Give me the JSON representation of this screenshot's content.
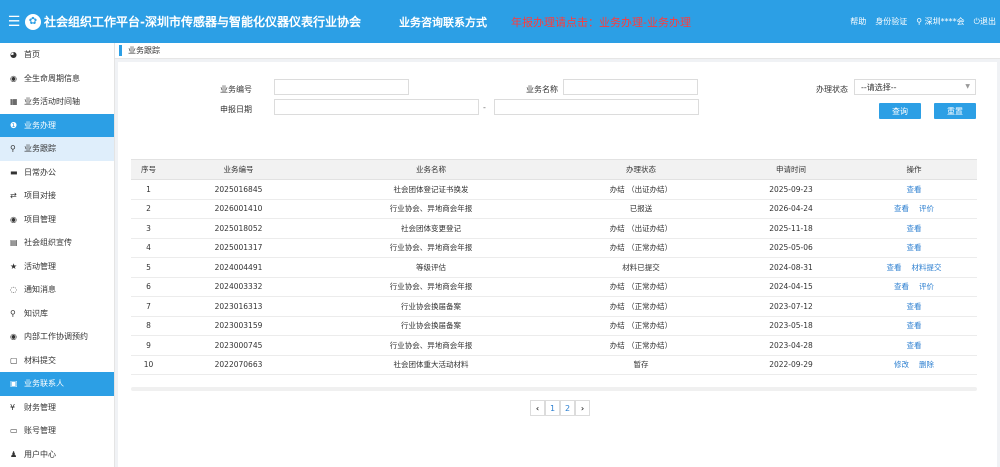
{
  "header": {
    "menu_icon": "hamburger-icon",
    "logo_icon": "globe-logo-icon",
    "title": "社会组织工作平台-深圳市传感器与智能化仪器仪表行业协会",
    "contact": "业务咨询联系方式",
    "notice": "年报办理请点击：业务办理-业务办理",
    "help": "帮助",
    "verify": "身份验证",
    "user": "深圳****会",
    "logout": "退出"
  },
  "sidebar": {
    "items": [
      {
        "label": "首页",
        "icon": "dashboard-icon"
      },
      {
        "label": "全生命周期信息",
        "icon": "eye-icon"
      },
      {
        "label": "业务活动时间轴",
        "icon": "calendar-icon"
      },
      {
        "label": "业务办理",
        "icon": "info-icon"
      },
      {
        "label": "业务跟踪",
        "icon": "search-icon"
      },
      {
        "label": "日常办公",
        "icon": "briefcase-icon"
      },
      {
        "label": "项目对接",
        "icon": "connect-icon"
      },
      {
        "label": "项目管理",
        "icon": "eye-icon"
      },
      {
        "label": "社会组织宣传",
        "icon": "newspaper-icon"
      },
      {
        "label": "活动管理",
        "icon": "star-icon"
      },
      {
        "label": "通知消息",
        "icon": "chat-icon"
      },
      {
        "label": "知识库",
        "icon": "search-icon"
      },
      {
        "label": "内部工作协调预约",
        "icon": "eye-icon"
      },
      {
        "label": "材料提交",
        "icon": "file-icon"
      },
      {
        "label": "业务联系人",
        "icon": "contact-icon"
      },
      {
        "label": "财务管理",
        "icon": "yen-icon"
      },
      {
        "label": "账号管理",
        "icon": "id-card-icon"
      },
      {
        "label": "用户中心",
        "icon": "user-icon"
      }
    ]
  },
  "breadcrumb": "业务跟踪",
  "search": {
    "biz_no_label": "业务编号",
    "biz_name_label": "业务名称",
    "status_label": "办理状态",
    "status_value": "--请选择--",
    "date_label": "申报日期",
    "date_sep": "-",
    "query_btn": "查询",
    "reset_btn": "重置"
  },
  "table": {
    "headers": [
      "序号",
      "业务编号",
      "业务名称",
      "办理状态",
      "申请时间",
      "操作"
    ],
    "rows": [
      {
        "no": "1",
        "code": "2025016845",
        "name": "社会团体登记证书换发",
        "status": "办结 （出证办结）",
        "date": "2025-09-23",
        "actions": [
          "查看"
        ]
      },
      {
        "no": "2",
        "code": "2026001410",
        "name": "行业协会、异地商会年报",
        "status": "已报送",
        "date": "2026-04-24",
        "actions": [
          "查看",
          "评价"
        ]
      },
      {
        "no": "3",
        "code": "2025018052",
        "name": "社会团体变更登记",
        "status": "办结 （出证办结）",
        "date": "2025-11-18",
        "actions": [
          "查看"
        ]
      },
      {
        "no": "4",
        "code": "2025001317",
        "name": "行业协会、异地商会年报",
        "status": "办结 （正常办结）",
        "date": "2025-05-06",
        "actions": [
          "查看"
        ]
      },
      {
        "no": "5",
        "code": "2024004491",
        "name": "等级评估",
        "status": "材料已提交",
        "date": "2024-08-31",
        "actions": [
          "查看",
          "材料提交"
        ]
      },
      {
        "no": "6",
        "code": "2024003332",
        "name": "行业协会、异地商会年报",
        "status": "办结 （正常办结）",
        "date": "2024-04-15",
        "actions": [
          "查看",
          "评价"
        ]
      },
      {
        "no": "7",
        "code": "2023016313",
        "name": "行业协会换届备案",
        "status": "办结 （正常办结）",
        "date": "2023-07-12",
        "actions": [
          "查看"
        ]
      },
      {
        "no": "8",
        "code": "2023003159",
        "name": "行业协会换届备案",
        "status": "办结 （正常办结）",
        "date": "2023-05-18",
        "actions": [
          "查看"
        ]
      },
      {
        "no": "9",
        "code": "2023000745",
        "name": "行业协会、异地商会年报",
        "status": "办结 （正常办结）",
        "date": "2023-04-28",
        "actions": [
          "查看"
        ]
      },
      {
        "no": "10",
        "code": "2022070663",
        "name": "社会团体重大活动材料",
        "status": "暂存",
        "date": "2022-09-29",
        "actions": [
          "修改",
          "删除"
        ]
      }
    ]
  },
  "pager": {
    "prev": "‹",
    "pages": [
      "1",
      "2"
    ],
    "next": "›"
  },
  "colors": {
    "primary": "#2c9fe5",
    "notice": "#ff3b3b",
    "link": "#2c7fd0"
  }
}
